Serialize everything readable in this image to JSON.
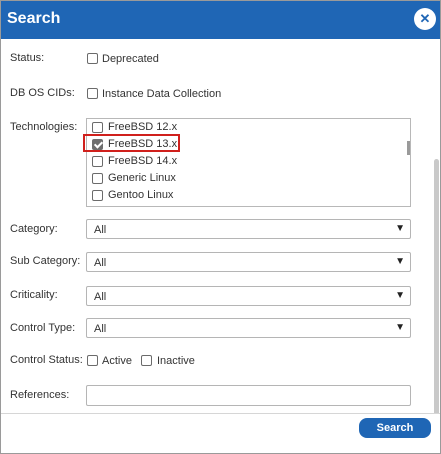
{
  "dialog": {
    "title": "Search",
    "close_icon": "close-icon"
  },
  "status": {
    "label": "Status:",
    "option": "Deprecated",
    "checked": false
  },
  "db_os_cids": {
    "label": "DB OS CIDs:",
    "option": "Instance Data Collection",
    "checked": false
  },
  "technologies": {
    "label": "Technologies:",
    "items": [
      {
        "label": "FreeBSD 12.x",
        "checked": false
      },
      {
        "label": "FreeBSD 13.x",
        "checked": true
      },
      {
        "label": "FreeBSD 14.x",
        "checked": false
      },
      {
        "label": "Generic Linux",
        "checked": false
      },
      {
        "label": "Gentoo Linux",
        "checked": false
      }
    ]
  },
  "category": {
    "label": "Category:",
    "value": "All"
  },
  "sub_category": {
    "label": "Sub Category:",
    "value": "All"
  },
  "criticality": {
    "label": "Criticality:",
    "value": "All"
  },
  "control_type": {
    "label": "Control Type:",
    "value": "All"
  },
  "control_status": {
    "label": "Control Status:",
    "active": "Active",
    "inactive": "Inactive"
  },
  "references": {
    "label": "References:",
    "value": ""
  },
  "footer": {
    "search_label": "Search"
  },
  "colors": {
    "accent": "#1f66b5",
    "highlight": "#d0201c"
  }
}
